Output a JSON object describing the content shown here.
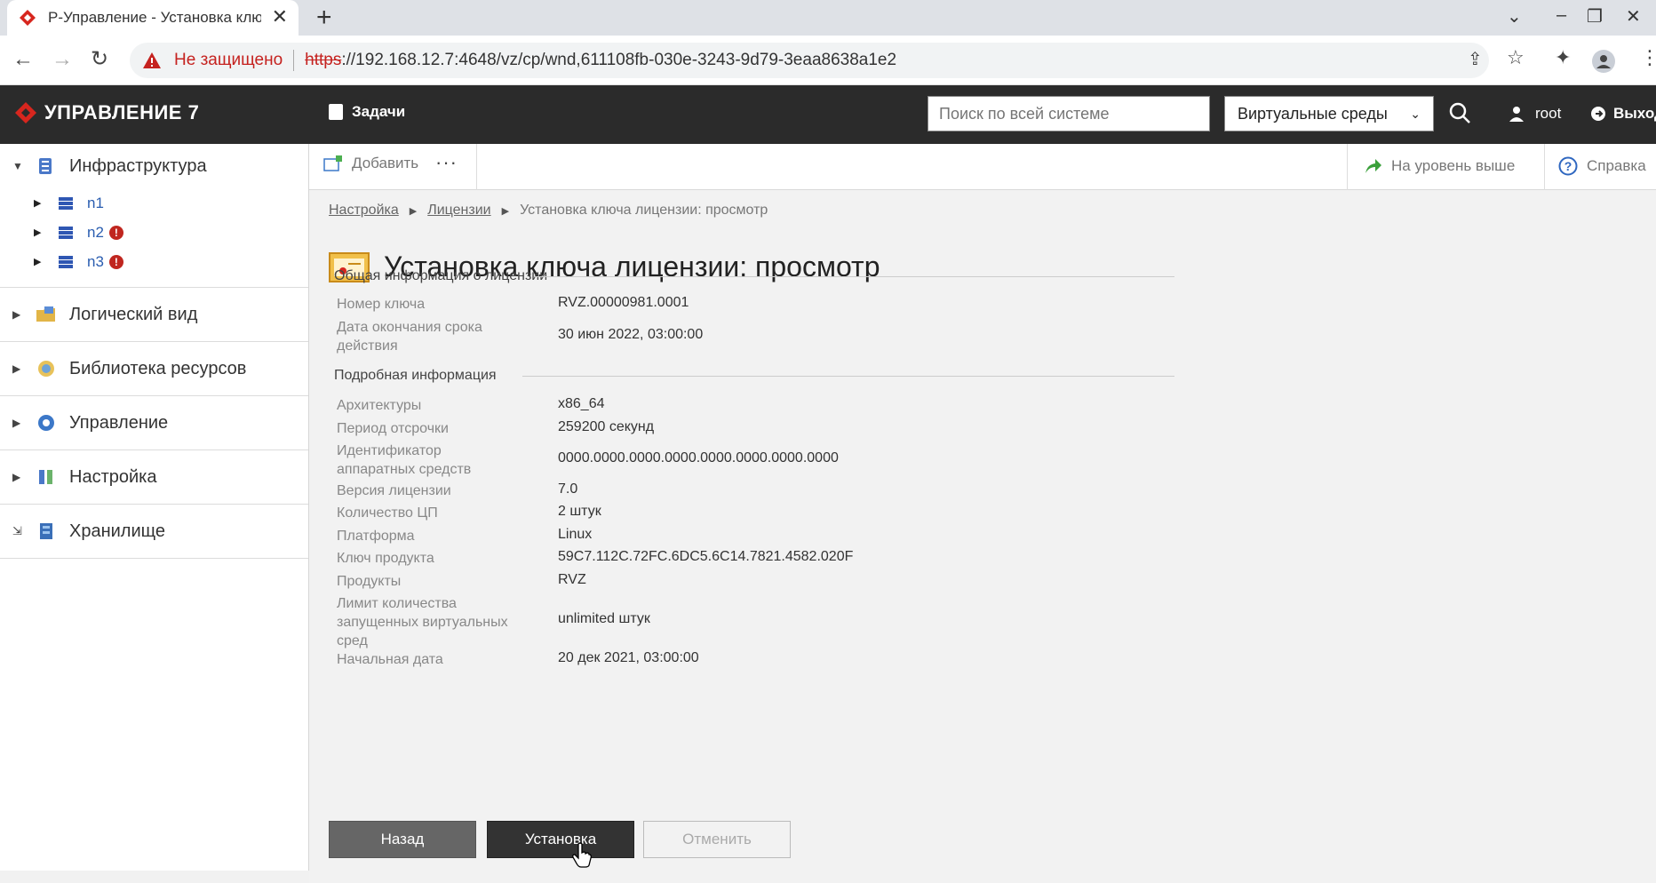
{
  "browser": {
    "tab_title": "Р-Управление - Установка клю",
    "not_secure": "Не защищено",
    "url_scheme": "https",
    "url_rest": "://192.168.12.7:4648/vz/cp/wnd,611108fb-030e-3243-9d79-3eaa8638a1e2"
  },
  "app": {
    "brand": "УПРАВЛЕНИЕ 7",
    "tasks_label": "Задачи",
    "search_placeholder": "Поиск по всей системе",
    "env_select": "Виртуальные среды",
    "user": "root",
    "logout": "Выход"
  },
  "sidebar": {
    "infrastructure": "Инфраструктура",
    "nodes": [
      "n1",
      "n2",
      "n3"
    ],
    "logical_view": "Логический вид",
    "resource_library": "Библиотека ресурсов",
    "management": "Управление",
    "settings": "Настройка",
    "storage": "Хранилище"
  },
  "toolbar": {
    "add": "Добавить",
    "more": "···",
    "level_up": "На уровень выше",
    "help": "Справка"
  },
  "breadcrumb": [
    "Настройка",
    "Лицензии",
    "Установка ключа лицензии: просмотр"
  ],
  "page_title": "Установка ключа лицензии: просмотр",
  "general_section": {
    "title": "Общая информация о лицензии",
    "rows": [
      {
        "label": "Номер ключа",
        "value": "RVZ.00000981.0001"
      },
      {
        "label": "Дата окончания срока действия",
        "value": "30 июн 2022, 03:00:00"
      }
    ]
  },
  "detail_section": {
    "title": "Подробная информация",
    "rows": [
      {
        "label": "Архитектуры",
        "value": "x86_64"
      },
      {
        "label": "Период отсрочки",
        "value": "259200 секунд"
      },
      {
        "label": "Идентификатор аппаратных средств",
        "value": "0000.0000.0000.0000.0000.0000.0000.0000"
      },
      {
        "label": "Версия лицензии",
        "value": "7.0"
      },
      {
        "label": "Количество ЦП",
        "value": "2 штук"
      },
      {
        "label": "Платформа",
        "value": "Linux"
      },
      {
        "label": "Ключ продукта",
        "value": "59C7.112C.72FC.6DC5.6C14.7821.4582.020F"
      },
      {
        "label": "Продукты",
        "value": "RVZ"
      },
      {
        "label": "Лимит количества запущенных виртуальных сред",
        "value": "unlimited штук"
      },
      {
        "label": "Начальная дата",
        "value": "20 дек 2021, 03:00:00"
      }
    ]
  },
  "buttons": {
    "back": "Назад",
    "install": "Установка",
    "cancel": "Отменить"
  },
  "colors": {
    "header_bg": "#2b2b2b",
    "brand_red": "#d7261e",
    "content_bg": "#f2f2f2"
  }
}
